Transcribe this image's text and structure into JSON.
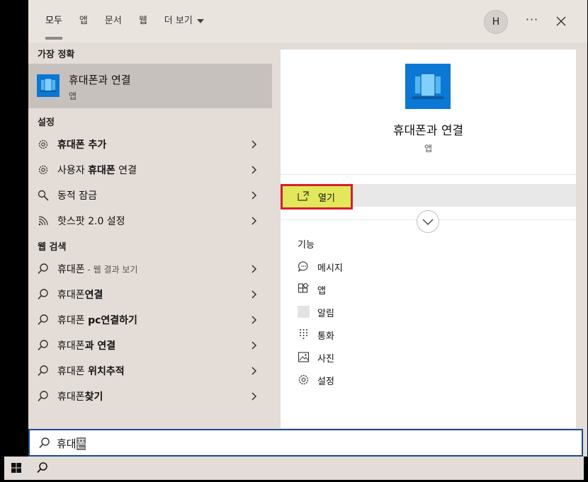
{
  "tabs": [
    {
      "label": "모두"
    },
    {
      "label": "앱"
    },
    {
      "label": "문서"
    },
    {
      "label": "웹"
    },
    {
      "label": "더 보기"
    }
  ],
  "avatar_initial": "H",
  "more_label": "···",
  "best_match": {
    "heading": "가장 정확",
    "title": "휴대폰과 연결",
    "subtitle": "앱"
  },
  "settings": {
    "heading": "설정",
    "items": [
      {
        "label": "휴대폰 추가",
        "icon": "gear-icon"
      },
      {
        "pre": "사용자 ",
        "bold": "휴대폰",
        "post": " 연결",
        "icon": "gear-icon"
      },
      {
        "label": "동적 잠금",
        "icon": "search-key-icon"
      },
      {
        "label": "핫스팟 2.0 설정",
        "icon": "wifi-icon"
      }
    ]
  },
  "web": {
    "heading": "웹 검색",
    "items": [
      {
        "pre": "휴대폰",
        "hint": " - 웹 결과 보기",
        "bold": ""
      },
      {
        "pre": "휴대폰",
        "bold": "연결",
        "hint": ""
      },
      {
        "pre": "휴대폰 ",
        "bold": "pc연결하기",
        "hint": ""
      },
      {
        "pre": "휴대폰",
        "bold": "과 연결",
        "hint": ""
      },
      {
        "pre": "휴대폰 ",
        "bold": "위치추적",
        "hint": ""
      },
      {
        "pre": "휴대폰",
        "bold": "찾기",
        "hint": ""
      }
    ]
  },
  "detail": {
    "title": "휴대폰과 연결",
    "subtitle": "앱",
    "open_label": "열기",
    "features_heading": "기능",
    "features": [
      {
        "label": "메시지",
        "icon": "message-icon"
      },
      {
        "label": "앱",
        "icon": "apps-icon"
      },
      {
        "label": "알림",
        "icon": "notification-icon"
      },
      {
        "label": "통화",
        "icon": "dialpad-icon"
      },
      {
        "label": "사진",
        "icon": "photo-icon"
      },
      {
        "label": "설정",
        "icon": "gear-icon"
      }
    ]
  },
  "search": {
    "typed": "휴대",
    "selected": "폰"
  },
  "colors": {
    "app_blue": "#0a78d4",
    "highlight_yellow": "#e3e85a",
    "highlight_border": "#d81e2a"
  }
}
